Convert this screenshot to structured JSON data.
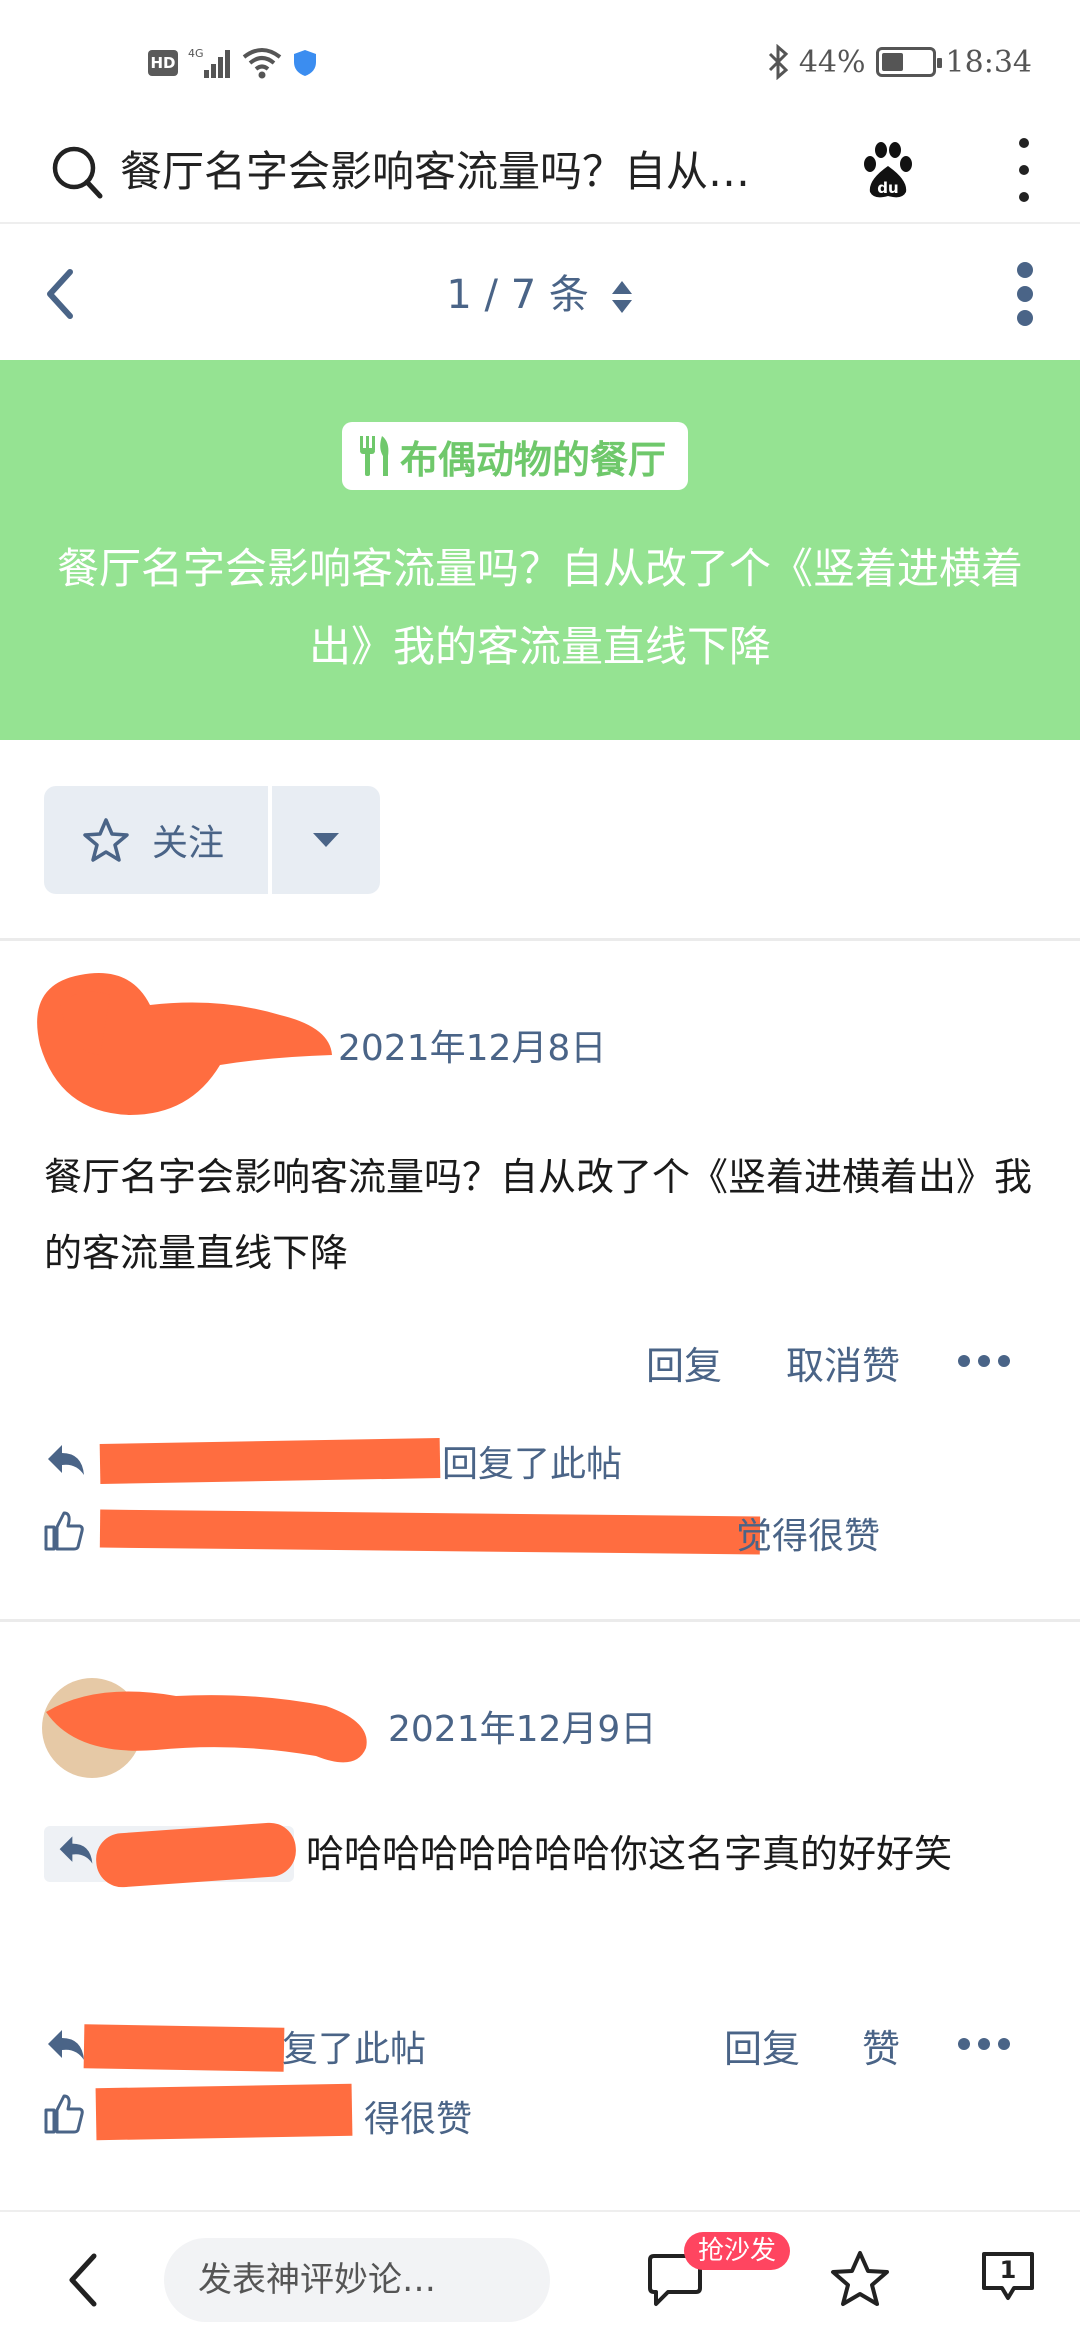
{
  "status_bar": {
    "hd": "HD",
    "network": "4G",
    "battery_percent": "44%",
    "battery_level": 0.44,
    "time": "18:34"
  },
  "search": {
    "title": "餐厅名字会影响客流量吗？自从…"
  },
  "nav": {
    "page_indicator": "1 / 7 条"
  },
  "banner": {
    "forum_name": "布偶动物的餐厅",
    "title": "餐厅名字会影响客流量吗？自从改了个《竖着进横着出》我的客流量直线下降",
    "background_color": "#95e392"
  },
  "follow": {
    "label": "关注"
  },
  "posts": [
    {
      "date": "2021年12月8日",
      "body": "餐厅名字会影响客流量吗？自从改了个《竖着进横着出》我的客流量直线下降",
      "reply_label": "回复",
      "like_label": "取消赞",
      "replied_suffix": "回复了此帖",
      "liked_suffix": "觉得很赞"
    },
    {
      "date": "2021年12月9日",
      "body": "哈哈哈哈哈哈哈哈你这名字真的好好笑",
      "reply_label": "回复",
      "like_label": "赞",
      "replied_suffix": "复了此帖",
      "liked_suffix": "得很赞"
    }
  ],
  "bottom_bar": {
    "comment_placeholder": "发表神评妙论…",
    "sofa_badge": "抢沙发",
    "page_count": "1"
  },
  "colors": {
    "accent": "#4a6487",
    "redaction": "#ff6d40",
    "badge": "#ff4560"
  }
}
